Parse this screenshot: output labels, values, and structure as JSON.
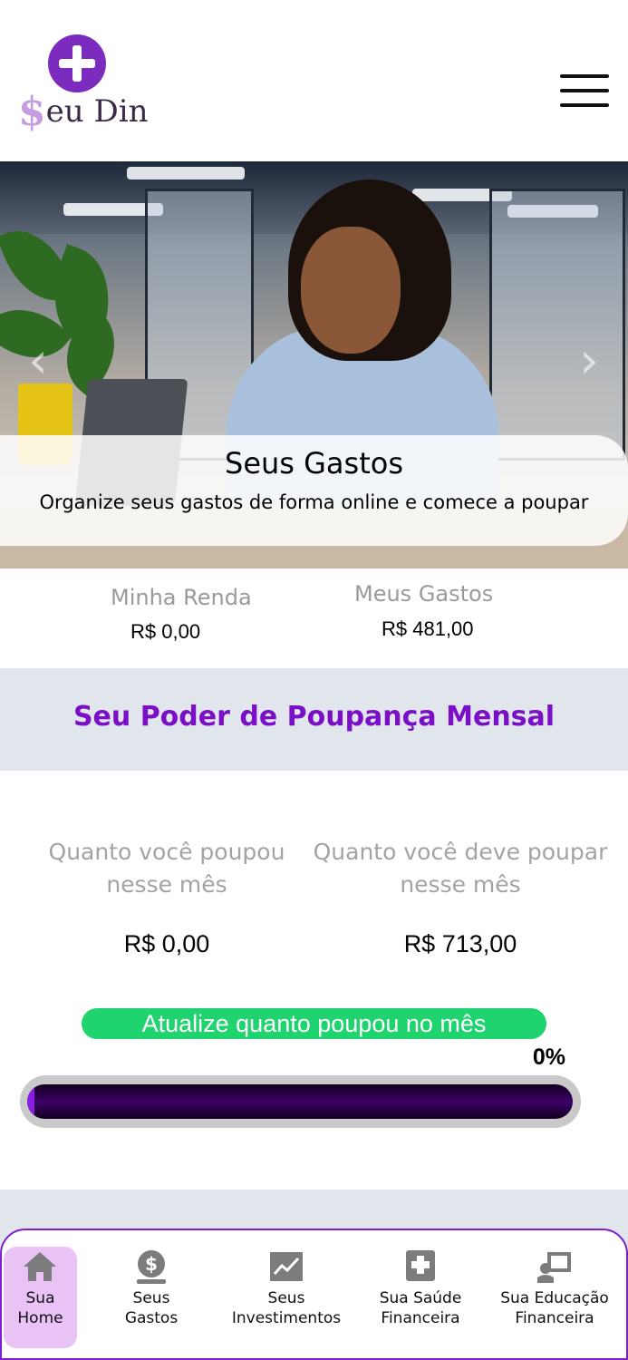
{
  "header": {
    "logo_text": "eu Din",
    "logo_dollar": "$",
    "menu_icon": "hamburger-icon"
  },
  "carousel": {
    "title": "Seus Gastos",
    "subtitle": "Organize seus gastos de forma online e comece a poupar",
    "prev_icon": "chevron-left-icon",
    "next_icon": "chevron-right-icon"
  },
  "totals": {
    "income_label": "Minha Renda",
    "income_value": "R$ 0,00",
    "expenses_label": "Meus Gastos",
    "expenses_value": "R$ 481,00"
  },
  "savings": {
    "section_title": "Seu Poder de Poupança Mensal",
    "saved_label": "Quanto você poupou nesse mês",
    "saved_value": "R$ 0,00",
    "target_label": "Quanto você deve poupar nesse mês",
    "target_value": "R$ 713,00",
    "update_button": "Atualize quanto poupou no mês",
    "progress_text": "0%",
    "progress_fraction": 0
  },
  "colors": {
    "brand_purple": "#7b0fc8",
    "update_green": "#1fd36e",
    "active_nav_bg": "#e9c3f5"
  },
  "bottom_nav": {
    "items": [
      {
        "label_line1": "Sua",
        "label_line2": "Home",
        "icon": "home-icon",
        "active": true
      },
      {
        "label_line1": "Seus",
        "label_line2": "Gastos",
        "icon": "dollar-coin-icon",
        "active": false
      },
      {
        "label_line1": "Seus",
        "label_line2": "Investimentos",
        "icon": "chart-line-icon",
        "active": false
      },
      {
        "label_line1": "Sua Saúde",
        "label_line2": "Financeira",
        "icon": "medical-book-icon",
        "active": false
      },
      {
        "label_line1": "Sua Educação",
        "label_line2": "Financeira",
        "icon": "teacher-board-icon",
        "active": false
      }
    ]
  }
}
